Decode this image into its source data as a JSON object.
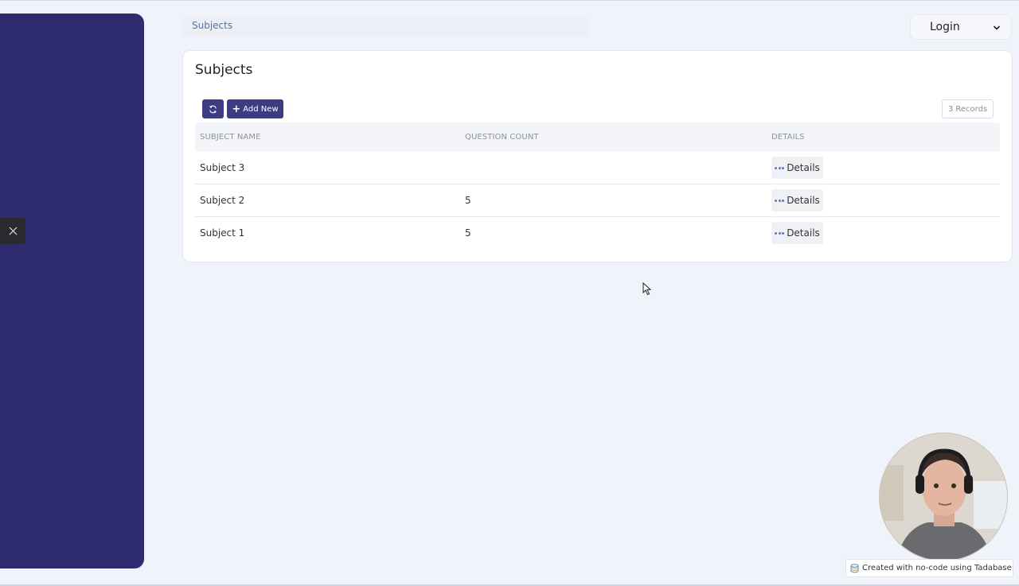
{
  "breadcrumb": {
    "current": "Subjects"
  },
  "user_menu": {
    "label": "Login"
  },
  "page": {
    "title": "Subjects",
    "add_new_label": "Add New",
    "records_label": "3 Records"
  },
  "table": {
    "columns": [
      "SUBJECT NAME",
      "QUESTION COUNT",
      "DETAILS"
    ],
    "rows": [
      {
        "name": "Subject 3",
        "question_count": "",
        "details_label": "Details"
      },
      {
        "name": "Subject 2",
        "question_count": "5",
        "details_label": "Details"
      },
      {
        "name": "Subject 1",
        "question_count": "5",
        "details_label": "Details"
      }
    ]
  },
  "footer": {
    "badge": "Created with no-code using Tadabase"
  },
  "colors": {
    "sidebar": "#2e2b6f",
    "primary_button": "#3d3b82",
    "page_bg": "#f1f3fa",
    "link": "#4f73a2"
  }
}
